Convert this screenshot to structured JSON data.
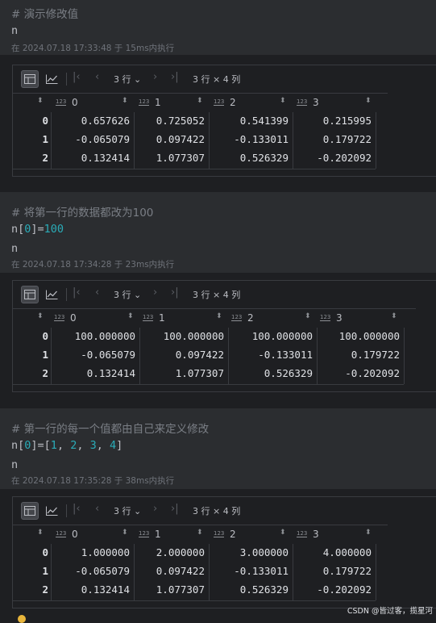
{
  "cells": [
    {
      "lines": [
        {
          "kind": "comment",
          "text": "# 演示修改值"
        },
        {
          "kind": "code",
          "text": "n"
        }
      ],
      "exec": "在 2024.07.18 17:33:48 于 15ms内执行",
      "result": {
        "rows_label": "3 行",
        "shape_label": "3 行 × 4 列",
        "columns": [
          "0",
          "1",
          "2",
          "3"
        ],
        "rows": [
          {
            "index": "0",
            "values": [
              "0.657626",
              "0.725052",
              "0.541399",
              "0.215995"
            ]
          },
          {
            "index": "1",
            "values": [
              "-0.065079",
              "0.097422",
              "-0.133011",
              "0.179722"
            ]
          },
          {
            "index": "2",
            "values": [
              "0.132414",
              "1.077307",
              "0.526329",
              "-0.202092"
            ]
          }
        ]
      }
    },
    {
      "lines": [
        {
          "kind": "comment",
          "text": "# 将第一行的数据都改为100"
        },
        {
          "kind": "code",
          "text": "n[0]=100"
        },
        {
          "kind": "code",
          "text": "n"
        }
      ],
      "exec": "在 2024.07.18 17:34:28 于 23ms内执行",
      "result": {
        "rows_label": "3 行",
        "shape_label": "3 行 × 4 列",
        "columns": [
          "0",
          "1",
          "2",
          "3"
        ],
        "rows": [
          {
            "index": "0",
            "values": [
              "100.000000",
              "100.000000",
              "100.000000",
              "100.000000"
            ]
          },
          {
            "index": "1",
            "values": [
              "-0.065079",
              "0.097422",
              "-0.133011",
              "0.179722"
            ]
          },
          {
            "index": "2",
            "values": [
              "0.132414",
              "1.077307",
              "0.526329",
              "-0.202092"
            ]
          }
        ]
      }
    },
    {
      "lines": [
        {
          "kind": "comment",
          "text": "# 第一行的每一个值都由自己来定义修改"
        },
        {
          "kind": "code",
          "text": "n[0]=[1, 2, 3, 4]"
        },
        {
          "kind": "code",
          "text": "n"
        }
      ],
      "exec": "在 2024.07.18 17:35:28 于 38ms内执行",
      "result": {
        "rows_label": "3 行",
        "shape_label": "3 行 × 4 列",
        "columns": [
          "0",
          "1",
          "2",
          "3"
        ],
        "rows": [
          {
            "index": "0",
            "values": [
              "1.000000",
              "2.000000",
              "3.000000",
              "4.000000"
            ]
          },
          {
            "index": "1",
            "values": [
              "-0.065079",
              "0.097422",
              "-0.133011",
              "0.179722"
            ]
          },
          {
            "index": "2",
            "values": [
              "0.132414",
              "1.077307",
              "0.526329",
              "-0.202092"
            ]
          }
        ]
      }
    }
  ],
  "type_badge": "123",
  "watermark": "CSDN @皆过客，揽星河",
  "icons": {
    "table_view": "table-icon",
    "chart_view": "line-chart-icon",
    "first": "first-page-icon",
    "prev": "previous-page-icon",
    "next": "next-page-icon",
    "last": "last-page-icon",
    "sort": "sort-icon",
    "dropdown": "chevron-down-icon"
  },
  "colors": {
    "background": "#1e1f22",
    "cell_background": "#2b2d30",
    "comment": "#7a7e85",
    "number": "#2aacb8",
    "text": "#bcbec4"
  }
}
